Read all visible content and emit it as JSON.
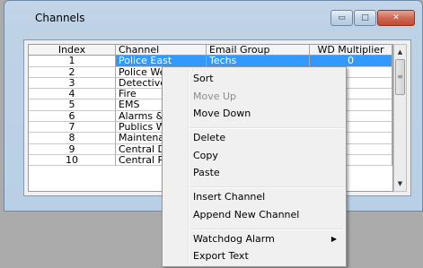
{
  "window": {
    "title": "Channels",
    "minimize_glyph": "▭",
    "maximize_glyph": "□",
    "close_glyph": "✕"
  },
  "grid": {
    "headers": [
      "Index",
      "Channel",
      "Email Group",
      "WD Multiplier"
    ],
    "rows": [
      {
        "index": "1",
        "channel": "Police East",
        "email": "Techs",
        "wd": "0"
      },
      {
        "index": "2",
        "channel": "Police We",
        "email": "",
        "wd": ""
      },
      {
        "index": "3",
        "channel": "Detective",
        "email": "",
        "wd": ""
      },
      {
        "index": "4",
        "channel": "Fire",
        "email": "",
        "wd": ""
      },
      {
        "index": "5",
        "channel": "EMS",
        "email": "",
        "wd": ""
      },
      {
        "index": "6",
        "channel": "Alarms &",
        "email": "",
        "wd": ""
      },
      {
        "index": "7",
        "channel": "Publics W",
        "email": "",
        "wd": ""
      },
      {
        "index": "8",
        "channel": "Maintena",
        "email": "",
        "wd": ""
      },
      {
        "index": "9",
        "channel": "Central D",
        "email": "",
        "wd": ""
      },
      {
        "index": "10",
        "channel": "Central P",
        "email": "",
        "wd": ""
      }
    ],
    "selected_row": 1
  },
  "scrollbar": {
    "up_glyph": "▲",
    "down_glyph": "▼",
    "thumb_glyph": "≡"
  },
  "context_menu": {
    "items": [
      {
        "label": "Sort",
        "enabled": true
      },
      {
        "label": "Move Up",
        "enabled": false
      },
      {
        "label": "Move Down",
        "enabled": true
      },
      {
        "label": "Delete",
        "enabled": true
      },
      {
        "label": "Copy",
        "enabled": true
      },
      {
        "label": "Paste",
        "enabled": true
      },
      {
        "label": "Insert Channel",
        "enabled": true
      },
      {
        "label": "Append New Channel",
        "enabled": true
      },
      {
        "label": "Watchdog Alarm",
        "enabled": true,
        "submenu": true,
        "submenu_glyph": "▶"
      },
      {
        "label": "Export Text",
        "enabled": true
      }
    ]
  }
}
